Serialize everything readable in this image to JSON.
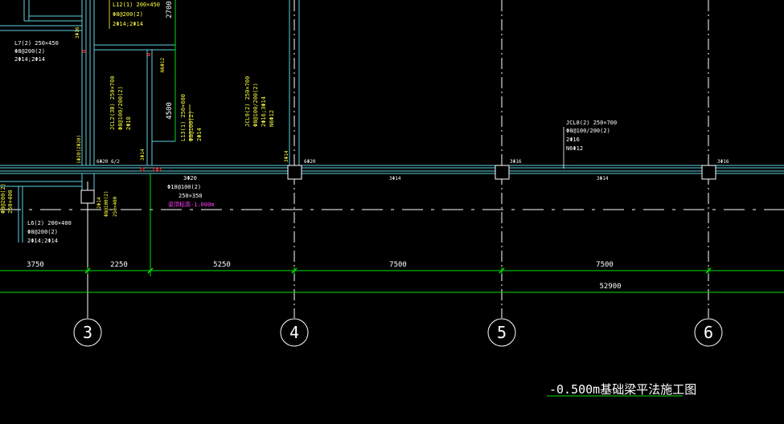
{
  "colors": {
    "background": "#000000",
    "beam": "#5fd0e0",
    "dimension": "#00e000",
    "axis": "#ffffff",
    "note_yellow": "#ffff40",
    "note_white": "#ffffff",
    "note_magenta": "#ff40ff",
    "rebar_red": "#ff3030"
  },
  "axes": [
    {
      "label": "3"
    },
    {
      "label": "4"
    },
    {
      "label": "5"
    },
    {
      "label": "6"
    }
  ],
  "dimensions": {
    "segments": [
      "3750",
      "2250",
      "5250",
      "7500",
      "7500"
    ],
    "total": "52900",
    "vertical": [
      "2700",
      "4500"
    ]
  },
  "beam_notes": {
    "l12": [
      "L12(1) 200×450",
      "Φ8@200(2)",
      "2Φ14;2Φ14"
    ],
    "l7": [
      "L7(2) 250×450",
      "Φ8@200(2)",
      "2Φ14;2Φ14"
    ],
    "jcl2": [
      "JCL2(3B) 250×700",
      "Φ8@100/200(2)",
      "2Φ18"
    ],
    "l13": [
      "L13(1) 250×600",
      "Φ8@100(2)",
      "2Φ14"
    ],
    "jcl9": [
      "JCL9(2) 250×700",
      "Φ8@100/200(2)",
      "2Φ16;3Φ14",
      "N6Φ12"
    ],
    "jcl8": [
      "JCL8(2) 250×700",
      "Φ8@100/200(2)",
      "2Φ16",
      "N6Φ12"
    ],
    "l6": [
      "L6(2) 200×400",
      "Φ8@200(2)",
      "2Φ14;2Φ14"
    ],
    "left_side": [
      "Φ8@200(2)",
      "250×400"
    ],
    "mid_beam": [
      "3Φ20",
      "Φ10@100(2)",
      "250×350"
    ],
    "elevation": "梁顶标高-1.000m",
    "side_small": [
      "3Φ16",
      "N6Φ12",
      "2Φ14",
      "Φ8@100(2)",
      "250×400"
    ]
  },
  "rebar_tags": {
    "t1": "6Φ20 6/2",
    "t2": "6Φ20",
    "t3": "3Φ16",
    "t4": "3Φ16",
    "t5": "3Φ14",
    "t6": "3Φ14",
    "t7": "3Φ14",
    "t8": "3Φ14",
    "t9": "1Φ20(2Φ20)"
  },
  "drawing_title": "-0.500m基础梁平法施工图"
}
